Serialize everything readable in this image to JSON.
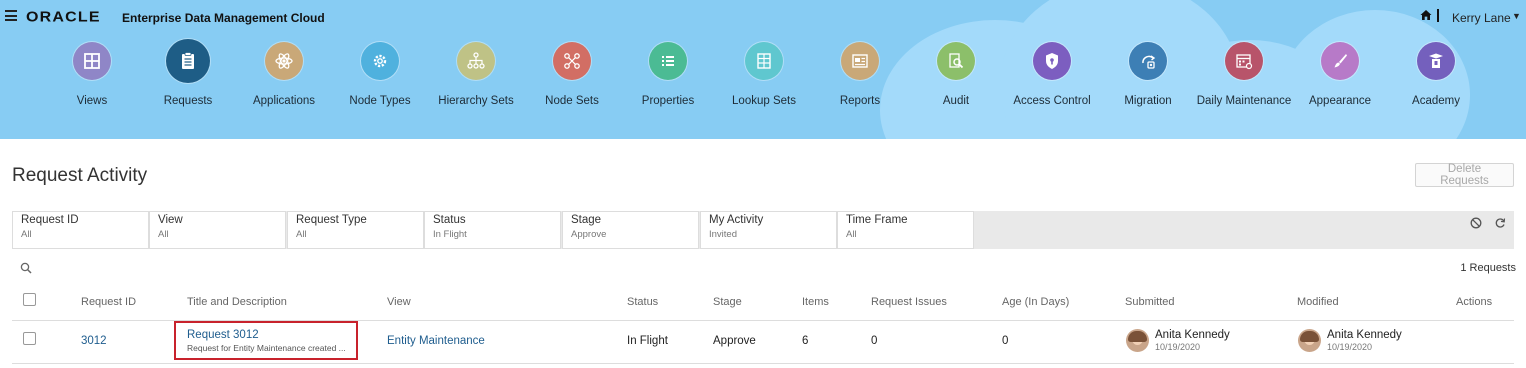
{
  "app": {
    "logo": "ORACLE",
    "title": "Enterprise Data Management Cloud",
    "user": "Kerry Lane"
  },
  "nav": [
    {
      "label": "Views",
      "icon": "grid-icon",
      "color": "#8f86c7"
    },
    {
      "label": "Requests",
      "icon": "clipboard-icon",
      "color": "#1e5d86"
    },
    {
      "label": "Applications",
      "icon": "atom-icon",
      "color": "#c9a878"
    },
    {
      "label": "Node Types",
      "icon": "gear-icon",
      "color": "#4fb1de"
    },
    {
      "label": "Hierarchy Sets",
      "icon": "hierarchy-icon",
      "color": "#bfc286"
    },
    {
      "label": "Node Sets",
      "icon": "nodes-icon",
      "color": "#d26e64"
    },
    {
      "label": "Properties",
      "icon": "list-icon",
      "color": "#4bbb94"
    },
    {
      "label": "Lookup Sets",
      "icon": "table-icon",
      "color": "#5fc7cf"
    },
    {
      "label": "Reports",
      "icon": "report-icon",
      "color": "#c9a878"
    },
    {
      "label": "Audit",
      "icon": "audit-icon",
      "color": "#8cbf6a"
    },
    {
      "label": "Access Control",
      "icon": "shield-icon",
      "color": "#7c5ec0"
    },
    {
      "label": "Migration",
      "icon": "migration-icon",
      "color": "#3d7fb5"
    },
    {
      "label": "Daily Maintenance",
      "icon": "calendar-icon",
      "color": "#b8546a"
    },
    {
      "label": "Appearance",
      "icon": "brush-icon",
      "color": "#b77ac8"
    },
    {
      "label": "Academy",
      "icon": "academy-icon",
      "color": "#7460bd"
    }
  ],
  "page": {
    "title": "Request Activity",
    "delete_label": "Delete Requests",
    "count_label": "1 Requests"
  },
  "filters": [
    {
      "label": "Request ID",
      "value": "All"
    },
    {
      "label": "View",
      "value": "All"
    },
    {
      "label": "Request Type",
      "value": "All"
    },
    {
      "label": "Status",
      "value": "In Flight"
    },
    {
      "label": "Stage",
      "value": "Approve"
    },
    {
      "label": "My Activity",
      "value": "Invited"
    },
    {
      "label": "Time Frame",
      "value": "All"
    }
  ],
  "columns": {
    "request_id": "Request ID",
    "title": "Title and Description",
    "view": "View",
    "status": "Status",
    "stage": "Stage",
    "items": "Items",
    "issues": "Request Issues",
    "age": "Age (In Days)",
    "submitted": "Submitted",
    "modified": "Modified",
    "actions": "Actions"
  },
  "rows": [
    {
      "request_id": "3012",
      "title": "Request 3012",
      "description": "Request for Entity Maintenance created ...",
      "view": "Entity Maintenance",
      "status": "In Flight",
      "stage": "Approve",
      "items": "6",
      "issues": "0",
      "age": "0",
      "submitted_by": "Anita Kennedy",
      "submitted_date": "10/19/2020",
      "modified_by": "Anita Kennedy",
      "modified_date": "10/19/2020"
    }
  ]
}
